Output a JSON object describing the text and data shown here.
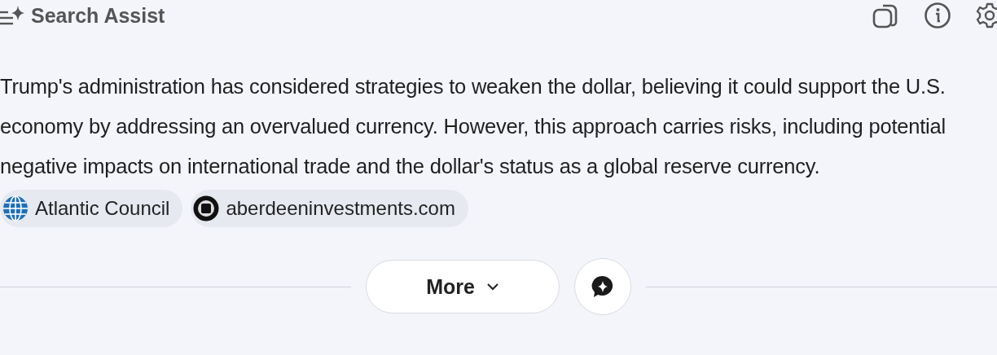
{
  "header": {
    "title": "Search Assist"
  },
  "answer": "Trump's administration has considered strategies to weaken the dollar, believing it could support the U.S. economy by addressing an overvalued currency. However, this approach carries risks, including potential negative impacts on international trade and the dollar's status as a global reserve currency.",
  "sources": [
    {
      "kind": "globe",
      "label": "Atlantic Council"
    },
    {
      "kind": "logo",
      "label": "aberdeeninvestments.com"
    }
  ],
  "more_button": {
    "label": "More"
  }
}
